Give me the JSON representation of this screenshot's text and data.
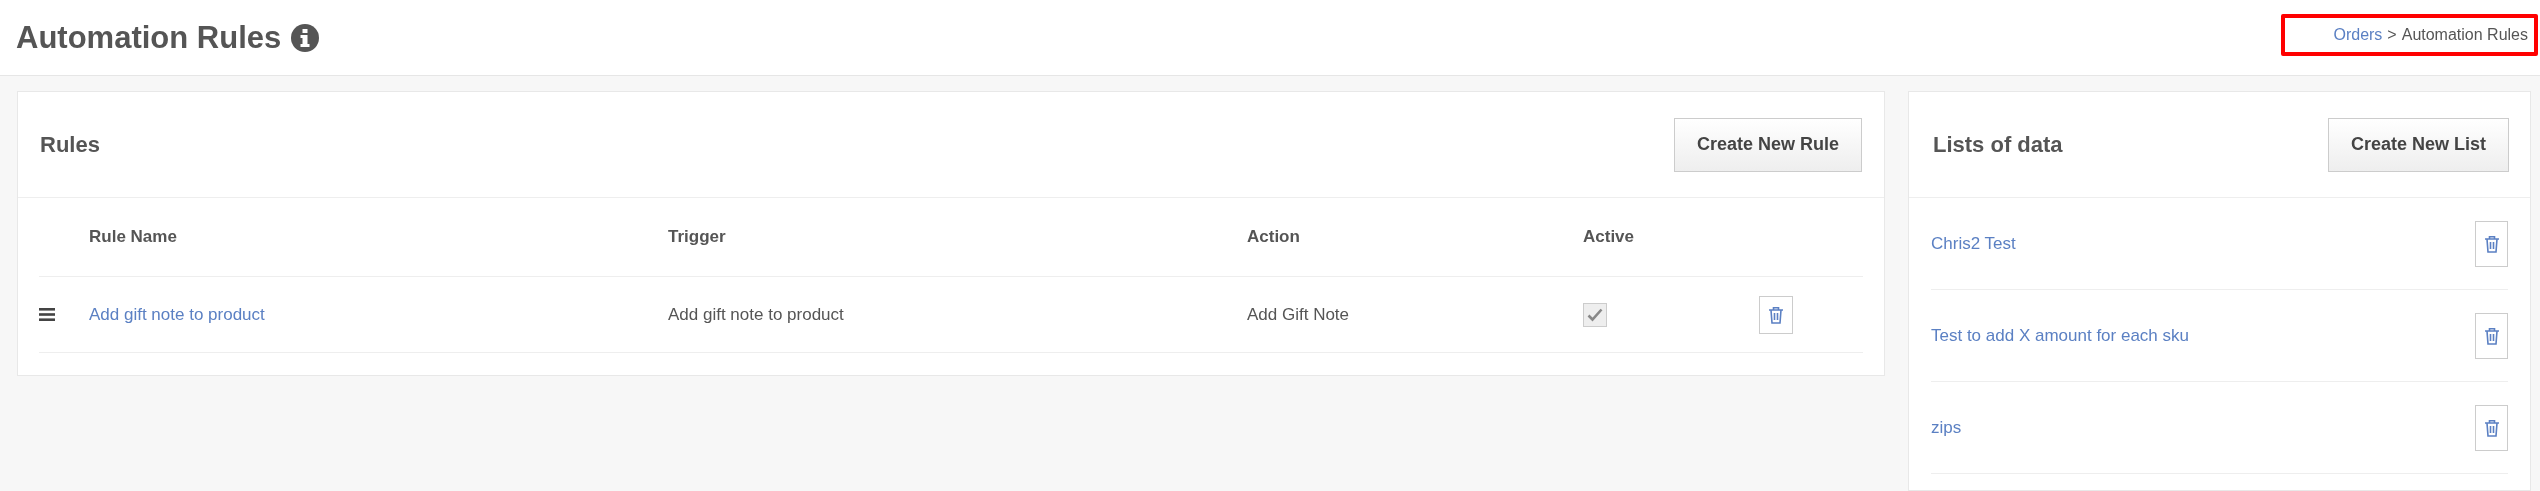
{
  "page": {
    "title": "Automation Rules"
  },
  "breadcrumb": {
    "highlighted": true,
    "items": [
      {
        "label": "Orders",
        "kind": "link"
      },
      {
        "label": ">",
        "kind": "separator"
      },
      {
        "label": "Automation Rules",
        "kind": "current"
      }
    ]
  },
  "rules": {
    "title": "Rules",
    "button": "Create New Rule",
    "columns": [
      "Rule Name",
      "Trigger",
      "Action",
      "Active"
    ],
    "rows": [
      {
        "name": "Add gift note to product",
        "trigger": "Add gift note to product",
        "action": "Add Gift Note",
        "active": true
      }
    ]
  },
  "lists": {
    "title": "Lists of data",
    "button": "Create New List",
    "items": [
      {
        "name": "Chris2 Test"
      },
      {
        "name": "Test to add X amount for each sku"
      },
      {
        "name": "zips"
      }
    ]
  }
}
